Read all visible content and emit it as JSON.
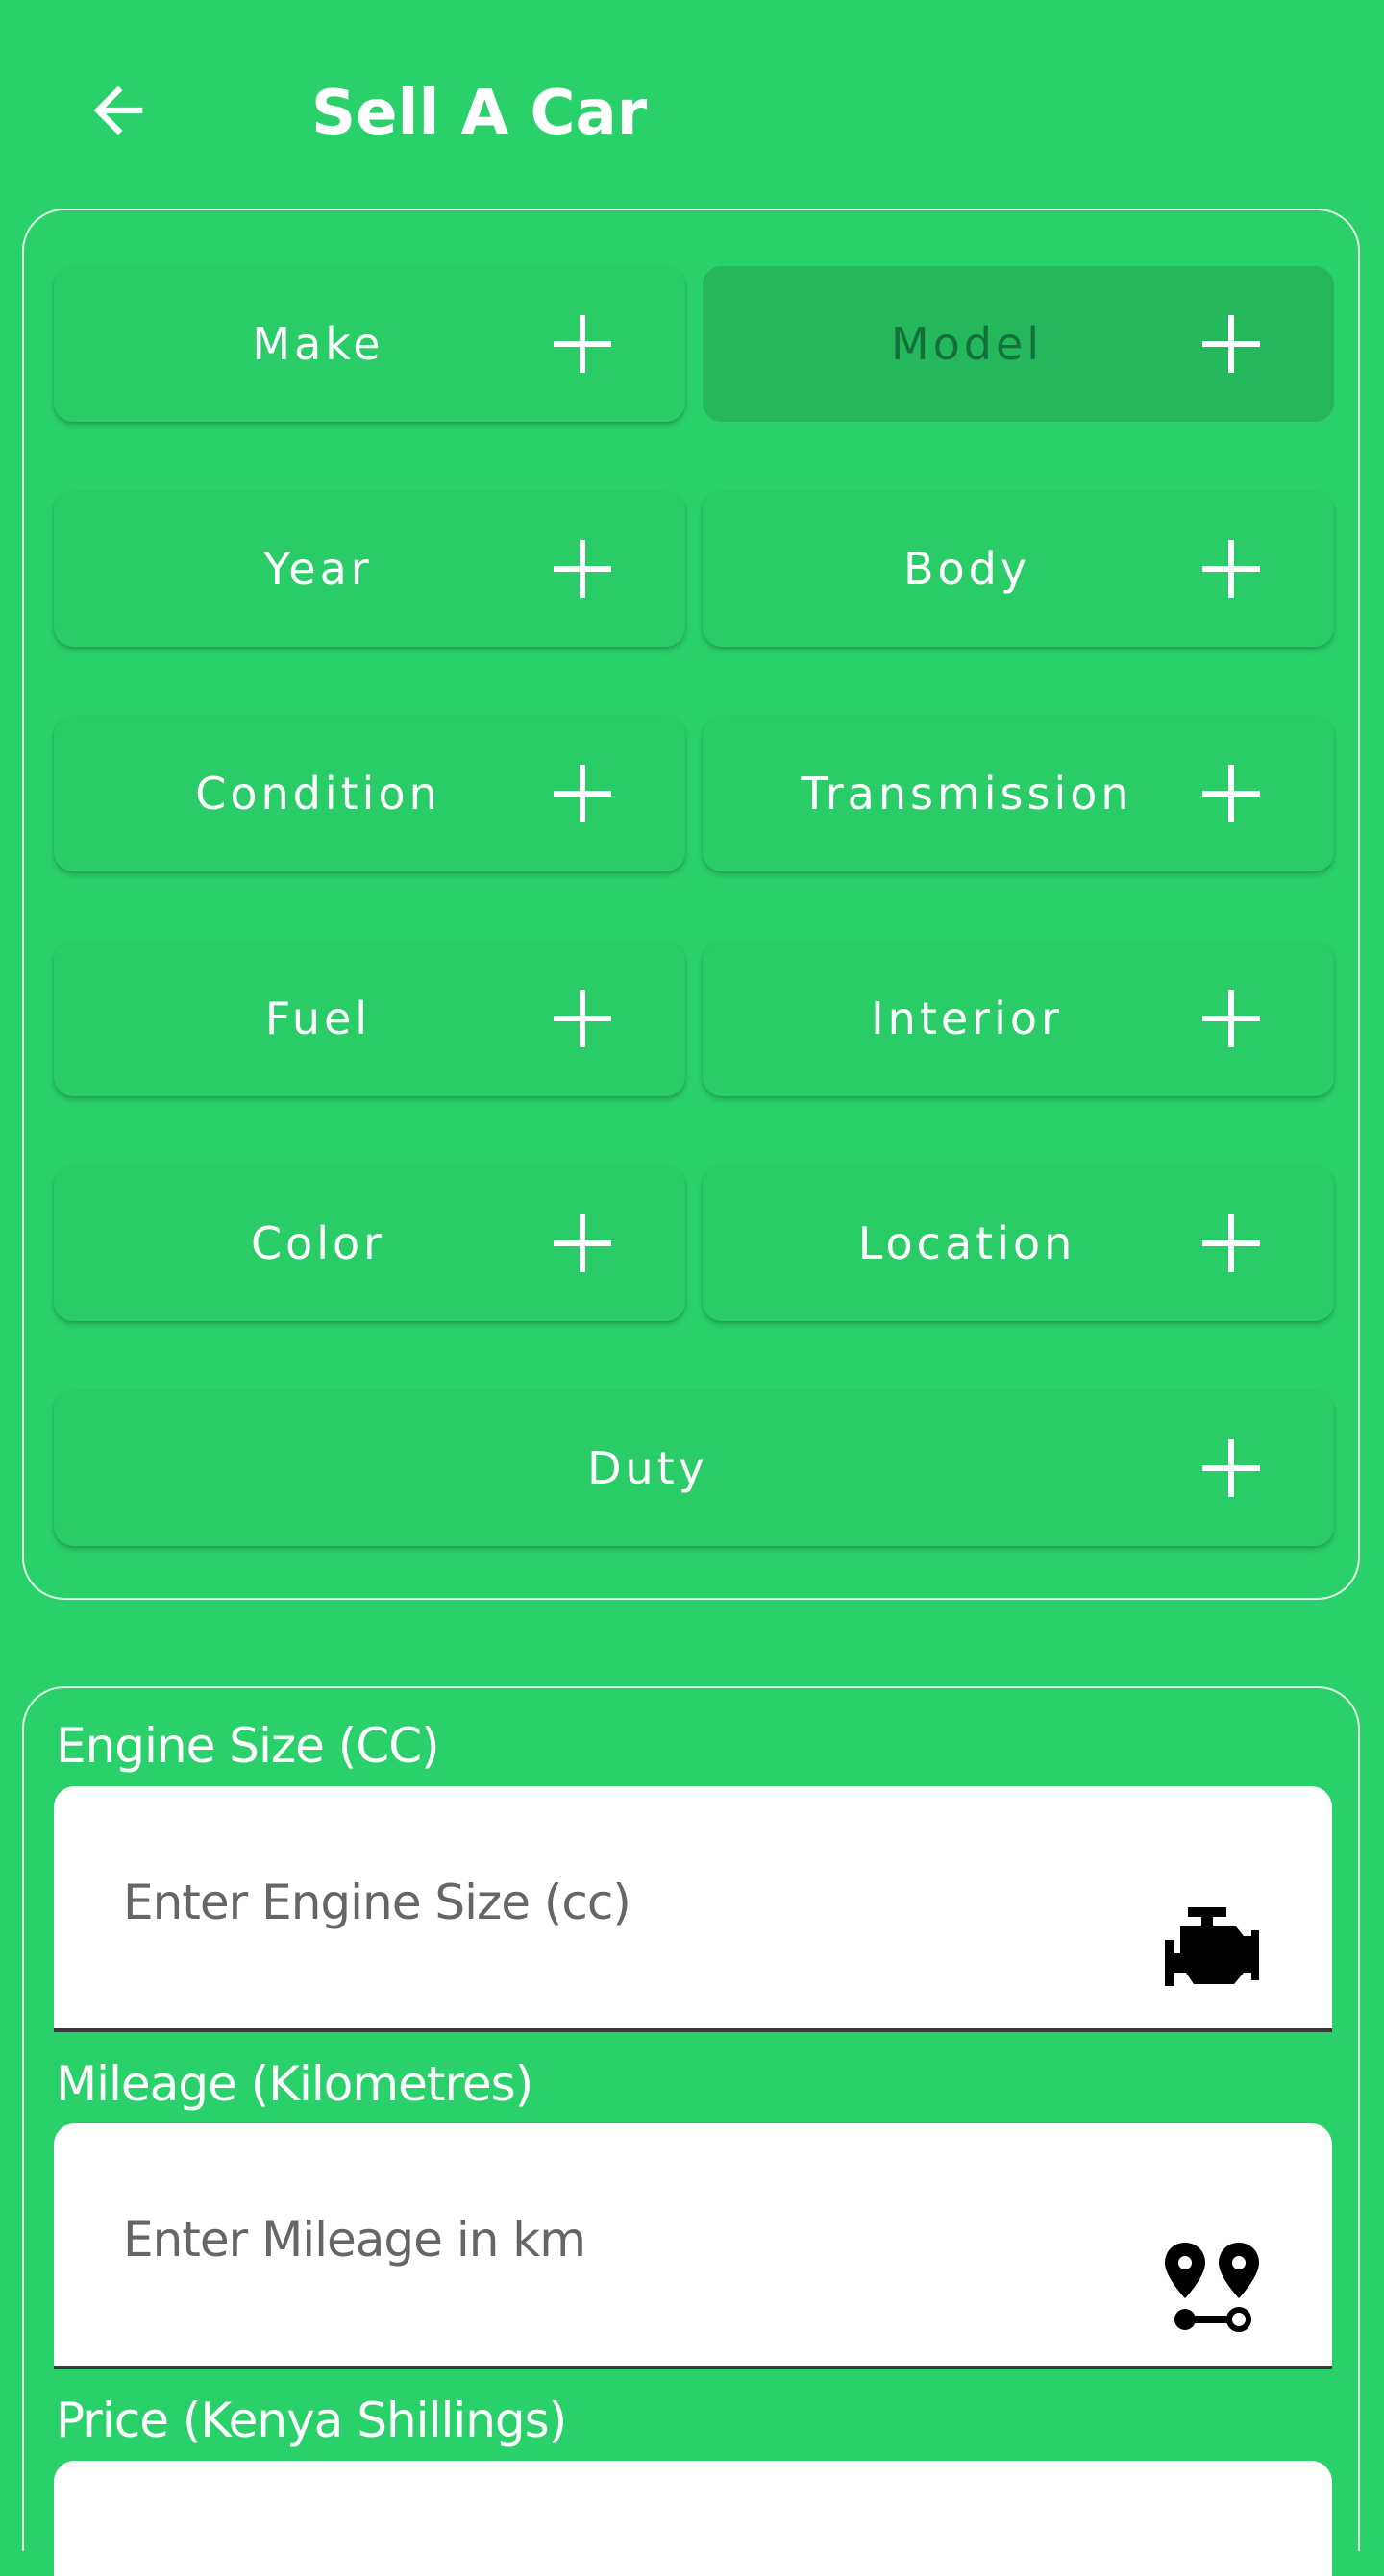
{
  "appbar": {
    "title": "Sell A Car",
    "back_icon": "arrow-left-icon"
  },
  "options": [
    {
      "label": "Make",
      "pressed": false
    },
    {
      "label": "Model",
      "pressed": true
    },
    {
      "label": "Year",
      "pressed": false
    },
    {
      "label": "Body",
      "pressed": false
    },
    {
      "label": "Condition",
      "pressed": false
    },
    {
      "label": "Transmission",
      "pressed": false
    },
    {
      "label": "Fuel",
      "pressed": false
    },
    {
      "label": "Interior",
      "pressed": false
    },
    {
      "label": "Color",
      "pressed": false
    },
    {
      "label": "Location",
      "pressed": false
    },
    {
      "label": "Duty",
      "pressed": false
    }
  ],
  "fields": {
    "engine": {
      "label": "Engine Size (CC)",
      "placeholder": "Enter Engine Size (cc)",
      "icon": "engine-icon"
    },
    "mileage": {
      "label": "Mileage (Kilometres)",
      "placeholder": "Enter Mileage in km",
      "icon": "route-pins-icon"
    },
    "price": {
      "label": "Price (Kenya Shillings)"
    }
  },
  "colors": {
    "background": "#2ad16a",
    "button": "#29cc67",
    "button_pressed": "#24b75b",
    "pressed_text": "#14703a"
  }
}
